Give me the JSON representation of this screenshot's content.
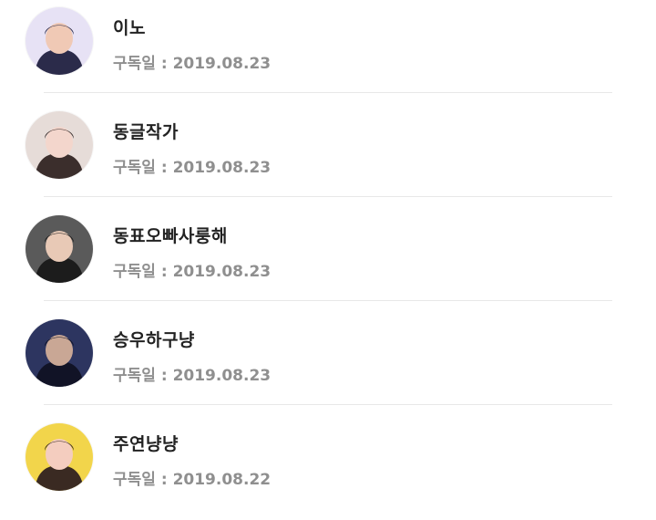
{
  "subscribers": [
    {
      "name": "이노",
      "date_label": "구독일",
      "date_separator": " : ",
      "date": "2019.08.23",
      "avatar_icon": "profile-photo-icon",
      "avatar_colors": [
        "#e7e2f5",
        "#2b2b4a",
        "#f0c9b5"
      ]
    },
    {
      "name": "동글작가",
      "date_label": "구독일",
      "date_separator": " : ",
      "date": "2019.08.23",
      "avatar_icon": "profile-photo-icon",
      "avatar_colors": [
        "#e6dcd8",
        "#3b2e2c",
        "#f3d6cc"
      ]
    },
    {
      "name": "동표오빠사룽해",
      "date_label": "구독일",
      "date_separator": " : ",
      "date": "2019.08.23",
      "avatar_icon": "profile-photo-icon",
      "avatar_colors": [
        "#5a5a5a",
        "#1c1c1c",
        "#e8c9b6"
      ]
    },
    {
      "name": "승우하구냥",
      "date_label": "구독일",
      "date_separator": " : ",
      "date": "2019.08.23",
      "avatar_icon": "profile-photo-icon",
      "avatar_colors": [
        "#2d3560",
        "#111326",
        "#c9a795"
      ]
    },
    {
      "name": "주연냥냥",
      "date_label": "구독일",
      "date_separator": " : ",
      "date": "2019.08.22",
      "avatar_icon": "profile-photo-icon",
      "avatar_colors": [
        "#f2d54b",
        "#3a2a22",
        "#f4cdbf"
      ]
    }
  ]
}
